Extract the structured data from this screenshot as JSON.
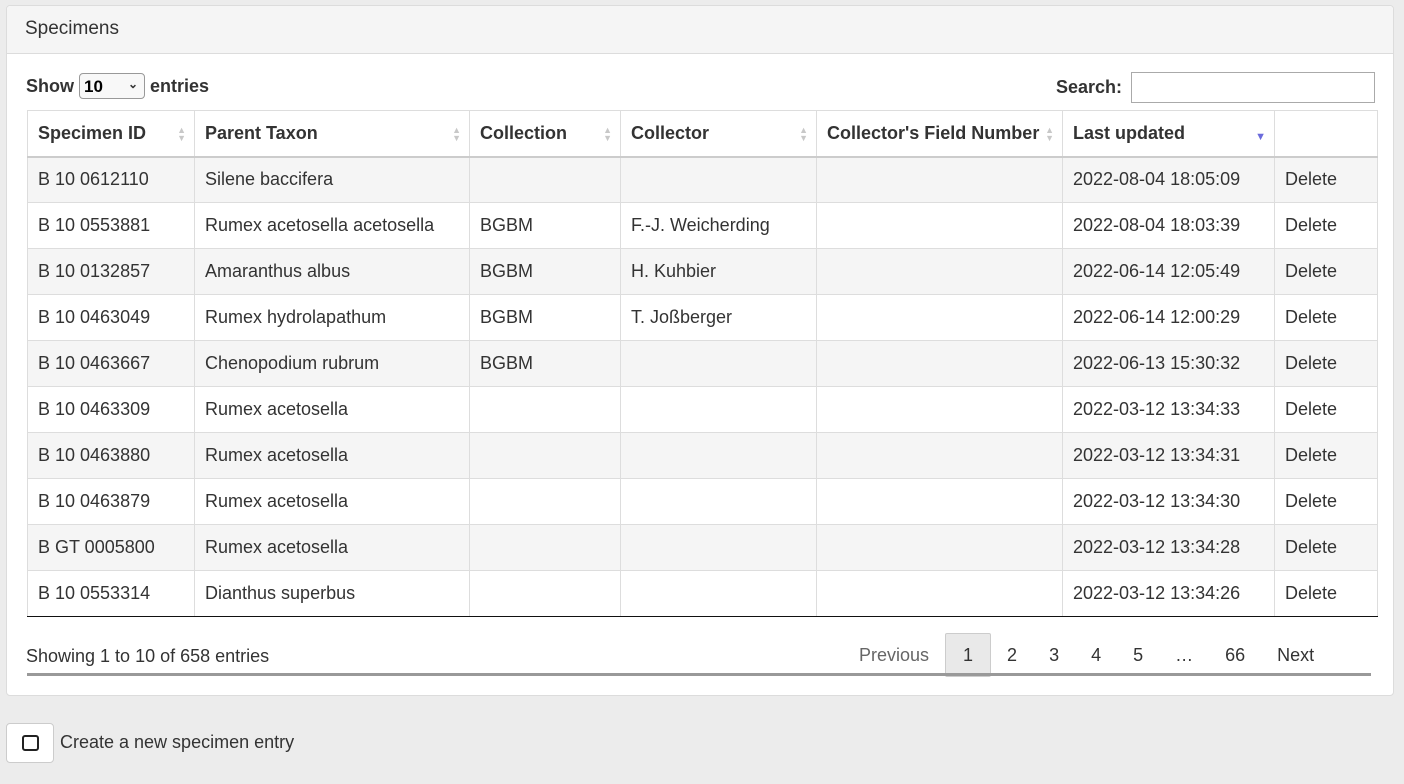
{
  "panel": {
    "title": "Specimens"
  },
  "length": {
    "prefix": "Show",
    "selected": "10",
    "suffix": "entries"
  },
  "search": {
    "label": "Search:",
    "value": ""
  },
  "columns": [
    "Specimen ID",
    "Parent Taxon",
    "Collection",
    "Collector",
    "Collector's Field Number",
    "Last updated",
    ""
  ],
  "rows": [
    [
      "B 10 0612110",
      "Silene baccifera",
      "",
      "",
      "",
      "2022-08-04 18:05:09",
      "Delete"
    ],
    [
      "B 10 0553881",
      "Rumex acetosella acetosella",
      "BGBM",
      "F.-J. Weicherding",
      "",
      "2022-08-04 18:03:39",
      "Delete"
    ],
    [
      "B 10 0132857",
      "Amaranthus albus",
      "BGBM",
      "H. Kuhbier",
      "",
      "2022-06-14 12:05:49",
      "Delete"
    ],
    [
      "B 10 0463049",
      "Rumex hydrolapathum",
      "BGBM",
      "T. Joßberger",
      "",
      "2022-06-14 12:00:29",
      "Delete"
    ],
    [
      "B 10 0463667",
      "Chenopodium rubrum",
      "BGBM",
      "",
      "",
      "2022-06-13 15:30:32",
      "Delete"
    ],
    [
      "B 10 0463309",
      "Rumex acetosella",
      "",
      "",
      "",
      "2022-03-12 13:34:33",
      "Delete"
    ],
    [
      "B 10 0463880",
      "Rumex acetosella",
      "",
      "",
      "",
      "2022-03-12 13:34:31",
      "Delete"
    ],
    [
      "B 10 0463879",
      "Rumex acetosella",
      "",
      "",
      "",
      "2022-03-12 13:34:30",
      "Delete"
    ],
    [
      "B GT 0005800",
      "Rumex acetosella",
      "",
      "",
      "",
      "2022-03-12 13:34:28",
      "Delete"
    ],
    [
      "B 10 0553314",
      "Dianthus superbus",
      "",
      "",
      "",
      "2022-03-12 13:34:26",
      "Delete"
    ]
  ],
  "info": "Showing 1 to 10 of 658 entries",
  "pagination": {
    "previous": "Previous",
    "pages": [
      "1",
      "2",
      "3",
      "4",
      "5",
      "…",
      "66"
    ],
    "current": "1",
    "next": "Next"
  },
  "footer": {
    "new_label": "Create a new specimen entry"
  },
  "colors": {
    "sort_active": "#6b6bdc",
    "striped_row": "#f5f5f5"
  }
}
